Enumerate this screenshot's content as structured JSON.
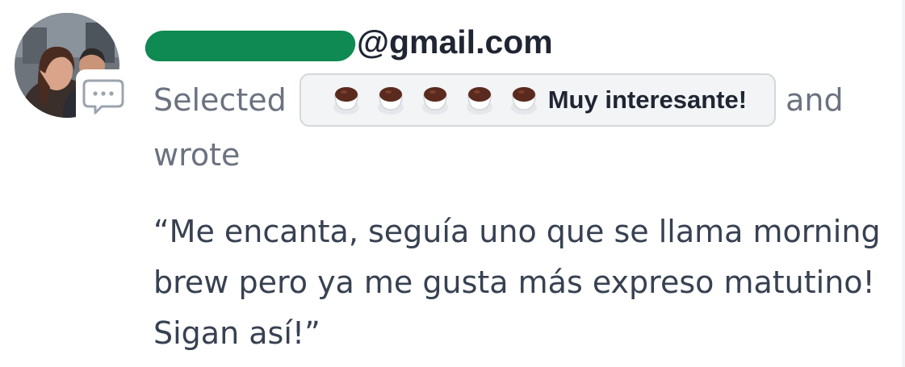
{
  "comment": {
    "email_domain": "@gmail.com",
    "action_prefix": "Selected",
    "action_conjunction": "and",
    "action_suffix": "wrote",
    "reaction": {
      "label": "Muy interesante!",
      "cups_count": 5,
      "icon": "coffee-cup-icon"
    },
    "quote_text": "“Me encanta, seguía uno que se llama morning brew pero ya me gusta más expreso matutino! Sigan así!”"
  },
  "icons": {
    "comment": "speech-bubble-icon",
    "avatar": "user-photo"
  },
  "colors": {
    "redaction": "#0f8a52",
    "coffee": "#5a2a1e",
    "muted_text": "#6b7280",
    "body_text": "#374151",
    "pill_bg": "#f3f4f6",
    "pill_border": "#d4d7dc"
  }
}
